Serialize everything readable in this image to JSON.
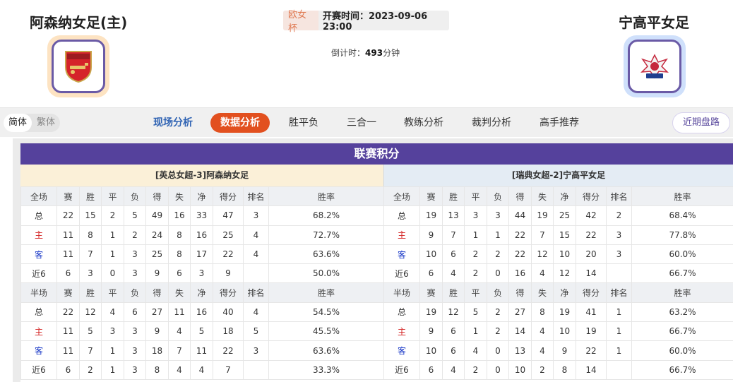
{
  "match": {
    "home_team": "阿森纳女足(主)",
    "away_team": "宁高平女足",
    "competition": "欧女杯",
    "start_time": "开赛时间：2023-09-06 23:00",
    "countdown_label": "倒计时：",
    "countdown_value": "493",
    "countdown_unit": "分钟"
  },
  "nav": {
    "lang_simplified": "简体",
    "lang_traditional": "繁体",
    "tabs": [
      "现场分析",
      "数据分析",
      "胜平负",
      "三合一",
      "教练分析",
      "裁判分析",
      "高手推荐"
    ],
    "active_tab": "数据分析",
    "recent_button": "近期盘路"
  },
  "standings": {
    "title": "联赛积分",
    "full_header": [
      "全场",
      "赛",
      "胜",
      "平",
      "负",
      "得",
      "失",
      "净",
      "得分",
      "排名",
      "胜率"
    ],
    "half_header": [
      "半场",
      "赛",
      "胜",
      "平",
      "负",
      "得",
      "失",
      "净",
      "得分",
      "排名",
      "胜率"
    ],
    "home": {
      "label": "[英总女超-3]阿森纳女足",
      "full": [
        [
          "总",
          "22",
          "15",
          "2",
          "5",
          "49",
          "16",
          "33",
          "47",
          "3",
          "68.2%"
        ],
        [
          "主",
          "11",
          "8",
          "1",
          "2",
          "24",
          "8",
          "16",
          "25",
          "4",
          "72.7%"
        ],
        [
          "客",
          "11",
          "7",
          "1",
          "3",
          "25",
          "8",
          "17",
          "22",
          "4",
          "63.6%"
        ],
        [
          "近6",
          "6",
          "3",
          "0",
          "3",
          "9",
          "6",
          "3",
          "9",
          "",
          "50.0%"
        ]
      ],
      "half": [
        [
          "总",
          "22",
          "12",
          "4",
          "6",
          "27",
          "11",
          "16",
          "40",
          "4",
          "54.5%"
        ],
        [
          "主",
          "11",
          "5",
          "3",
          "3",
          "9",
          "4",
          "5",
          "18",
          "5",
          "45.5%"
        ],
        [
          "客",
          "11",
          "7",
          "1",
          "3",
          "18",
          "7",
          "11",
          "22",
          "3",
          "63.6%"
        ],
        [
          "近6",
          "6",
          "2",
          "1",
          "3",
          "8",
          "4",
          "4",
          "7",
          "",
          "33.3%"
        ]
      ]
    },
    "away": {
      "label": "[瑞典女超-2]宁高平女足",
      "full": [
        [
          "总",
          "19",
          "13",
          "3",
          "3",
          "44",
          "19",
          "25",
          "42",
          "2",
          "68.4%"
        ],
        [
          "主",
          "9",
          "7",
          "1",
          "1",
          "22",
          "7",
          "15",
          "22",
          "3",
          "77.8%"
        ],
        [
          "客",
          "10",
          "6",
          "2",
          "2",
          "22",
          "12",
          "10",
          "20",
          "3",
          "60.0%"
        ],
        [
          "近6",
          "6",
          "4",
          "2",
          "0",
          "16",
          "4",
          "12",
          "14",
          "",
          "66.7%"
        ]
      ],
      "half": [
        [
          "总",
          "19",
          "12",
          "5",
          "2",
          "27",
          "8",
          "19",
          "41",
          "1",
          "63.2%"
        ],
        [
          "主",
          "9",
          "6",
          "1",
          "2",
          "14",
          "4",
          "10",
          "19",
          "1",
          "66.7%"
        ],
        [
          "客",
          "10",
          "6",
          "4",
          "0",
          "13",
          "4",
          "9",
          "22",
          "1",
          "60.0%"
        ],
        [
          "近6",
          "6",
          "4",
          "2",
          "0",
          "10",
          "2",
          "8",
          "14",
          "",
          "66.7%"
        ]
      ]
    }
  },
  "colors": {
    "accent": "#55419c",
    "active_tab": "#e2501f",
    "home_row": "#d31f1f",
    "away_row": "#1a39c7"
  }
}
